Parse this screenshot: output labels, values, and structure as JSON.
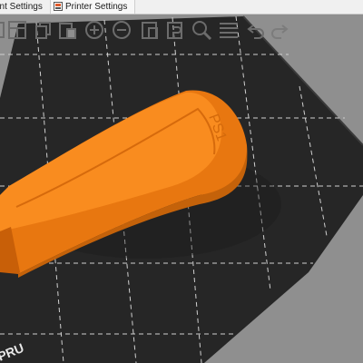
{
  "tabs": [
    {
      "label": "ent Settings",
      "icon": "gear-icon"
    },
    {
      "label": "Printer Settings",
      "icon": "printer-settings-icon"
    }
  ],
  "toolbar": [
    {
      "icon": "delete-icon"
    },
    {
      "icon": "arrange-icon"
    },
    {
      "icon": "copy-icon"
    },
    {
      "icon": "paste-icon"
    },
    {
      "icon": "add-instance-icon"
    },
    {
      "icon": "remove-instance-icon"
    },
    {
      "icon": "split-to-objects-icon"
    },
    {
      "icon": "split-to-parts-icon"
    },
    {
      "icon": "search-icon"
    },
    {
      "icon": "layers-editing-icon"
    },
    {
      "icon": "undo-icon"
    },
    {
      "icon": "redo-icon"
    }
  ],
  "model": {
    "embossed_text": "PS1",
    "color": "#f58220"
  },
  "bed": {
    "label_fragment": "PRU",
    "color": "#262626",
    "grid_color": "#d0d0d0"
  },
  "colors": {
    "background": "#8f8f8f",
    "toolbar_icon": "#6c6c6c",
    "tab_bar": "#f0f0f0"
  }
}
